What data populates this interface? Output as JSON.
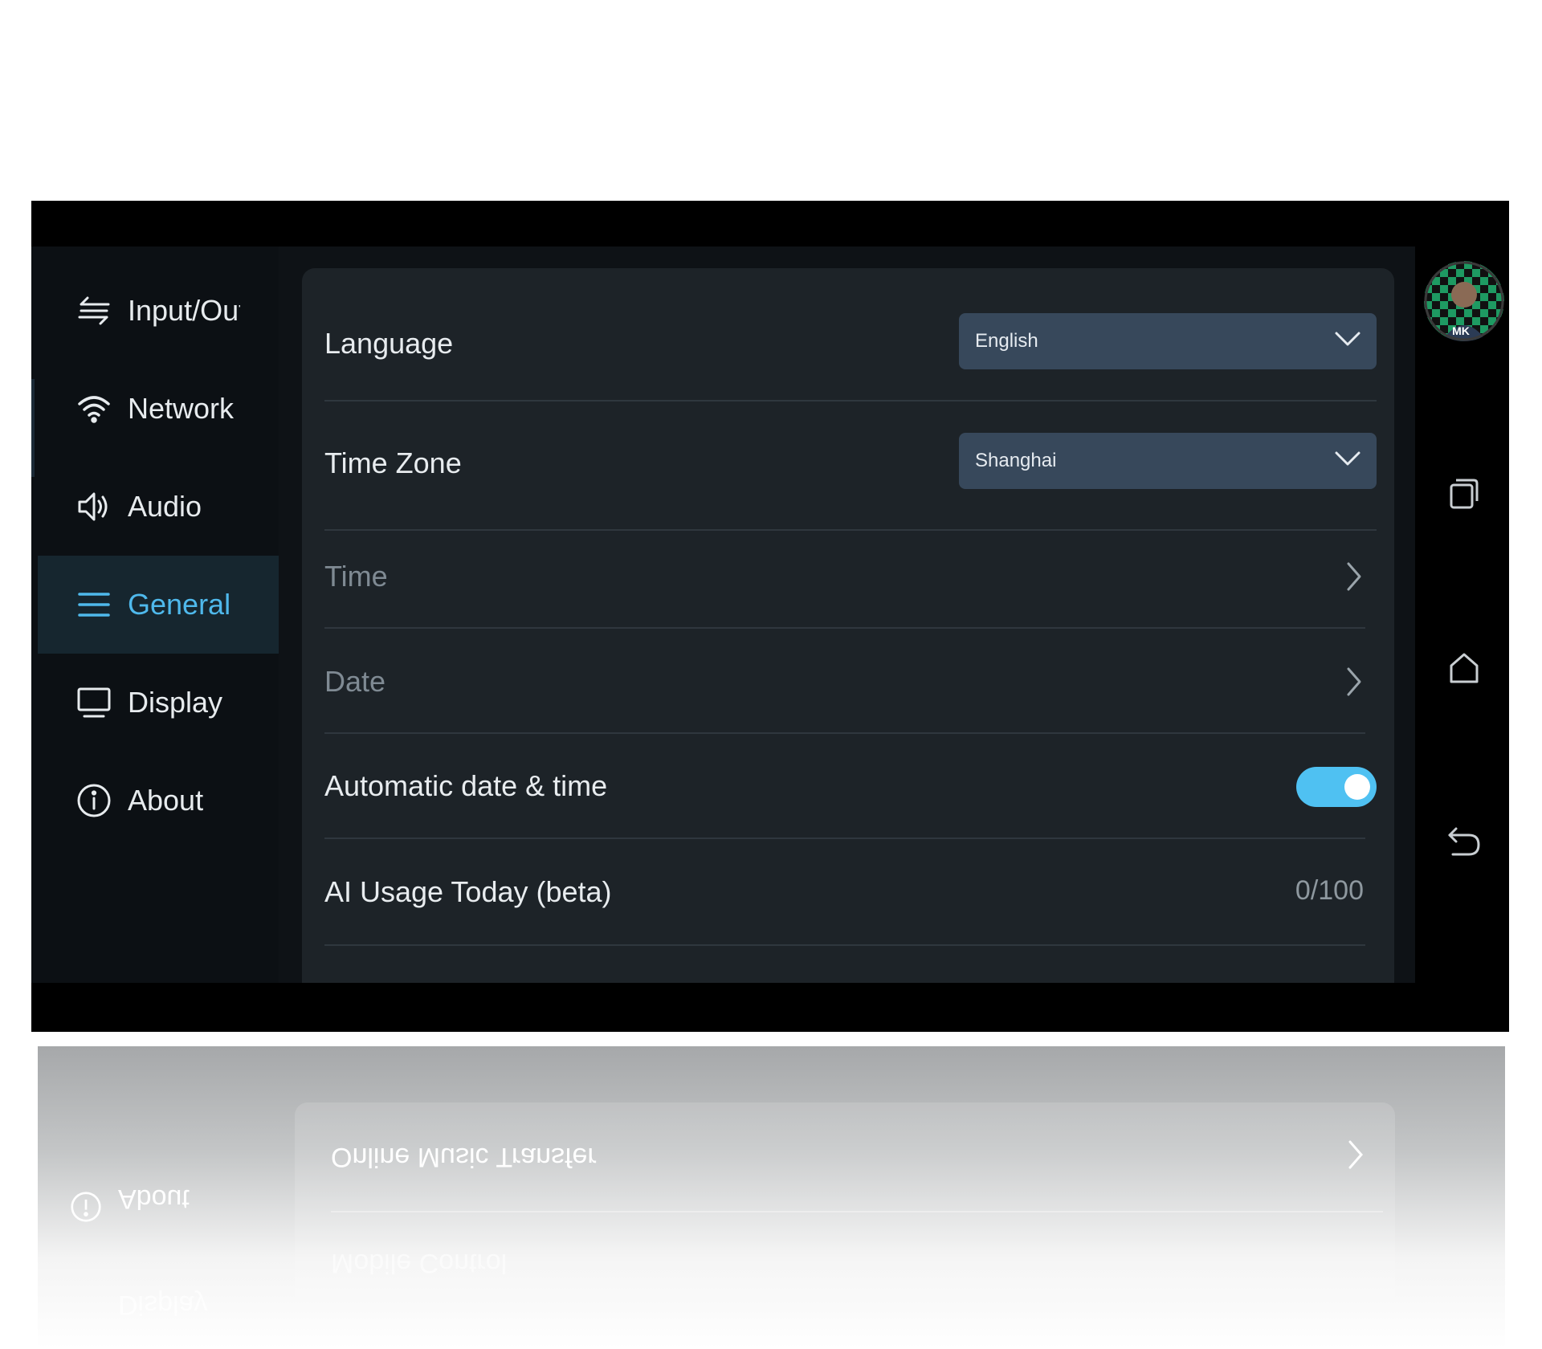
{
  "sidebar": {
    "items": [
      {
        "label": "Input/Output",
        "icon": "input-output-icon",
        "active": false
      },
      {
        "label": "Network",
        "icon": "wifi-icon",
        "active": false
      },
      {
        "label": "Audio",
        "icon": "speaker-icon",
        "active": false
      },
      {
        "label": "General",
        "icon": "menu-icon",
        "active": true
      },
      {
        "label": "Display",
        "icon": "monitor-icon",
        "active": false
      },
      {
        "label": "About",
        "icon": "info-icon",
        "active": false
      }
    ]
  },
  "settings": {
    "language": {
      "label": "Language",
      "value": "English"
    },
    "timezone": {
      "label": "Time Zone",
      "value": "Shanghai"
    },
    "time": {
      "label": "Time"
    },
    "date": {
      "label": "Date"
    },
    "auto_datetime": {
      "label": "Automatic date & time",
      "enabled": true
    },
    "ai_usage": {
      "label": "AI Usage Today (beta)",
      "value": "0/100"
    }
  },
  "rightbar": {
    "avatar_initials": "MK",
    "icons": [
      "recent-apps-icon",
      "home-icon",
      "back-icon"
    ]
  },
  "reflection": {
    "items": [
      "Online Music Transfer",
      "Mobile Control",
      "About",
      "Display"
    ]
  },
  "colors": {
    "accent": "#4fc1f2",
    "active_text": "#4fb9ec",
    "panel": "#1d2328",
    "dropdown": "#37485b",
    "background": "#0e1216"
  }
}
